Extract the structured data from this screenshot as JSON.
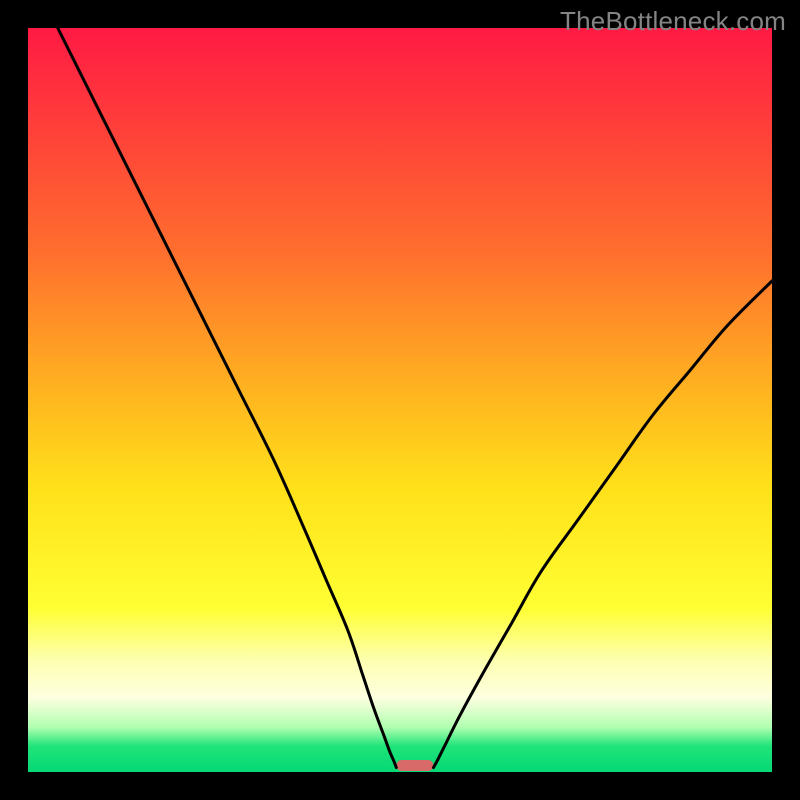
{
  "watermark": "TheBottleneck.com",
  "chart_data": {
    "type": "line",
    "title": "",
    "xlabel": "",
    "ylabel": "",
    "xlim": [
      0,
      100
    ],
    "ylim": [
      0,
      100
    ],
    "gradient_stops": [
      {
        "offset": 0.0,
        "color": "#ff1a44"
      },
      {
        "offset": 0.12,
        "color": "#ff3b3b"
      },
      {
        "offset": 0.3,
        "color": "#ff6e2e"
      },
      {
        "offset": 0.5,
        "color": "#ffb81f"
      },
      {
        "offset": 0.62,
        "color": "#ffe11a"
      },
      {
        "offset": 0.78,
        "color": "#ffff33"
      },
      {
        "offset": 0.85,
        "color": "#fdffb0"
      },
      {
        "offset": 0.9,
        "color": "#feffe0"
      },
      {
        "offset": 0.94,
        "color": "#b0ffb0"
      },
      {
        "offset": 0.965,
        "color": "#20e47a"
      },
      {
        "offset": 1.0,
        "color": "#05d874"
      }
    ],
    "series": [
      {
        "name": "left-curve",
        "x": [
          4.0,
          10,
          16,
          22,
          28,
          33,
          37,
          40,
          43,
          45,
          46.5,
          47.8,
          48.6,
          49.2,
          49.5
        ],
        "values": [
          100,
          88,
          76,
          64,
          52,
          42,
          33,
          26,
          19,
          13,
          8.5,
          5.0,
          2.8,
          1.4,
          0.6
        ]
      },
      {
        "name": "right-curve",
        "x": [
          54.5,
          55.0,
          56,
          58,
          61,
          65,
          69,
          74,
          79,
          84,
          89,
          94,
          100
        ],
        "values": [
          0.6,
          1.5,
          3.5,
          7.5,
          13,
          20,
          27,
          34,
          41,
          48,
          54,
          60,
          66
        ]
      }
    ],
    "marker": {
      "name": "bottleneck-marker",
      "x_center": 52.0,
      "width": 5.0,
      "color": "#d86a6a"
    }
  }
}
